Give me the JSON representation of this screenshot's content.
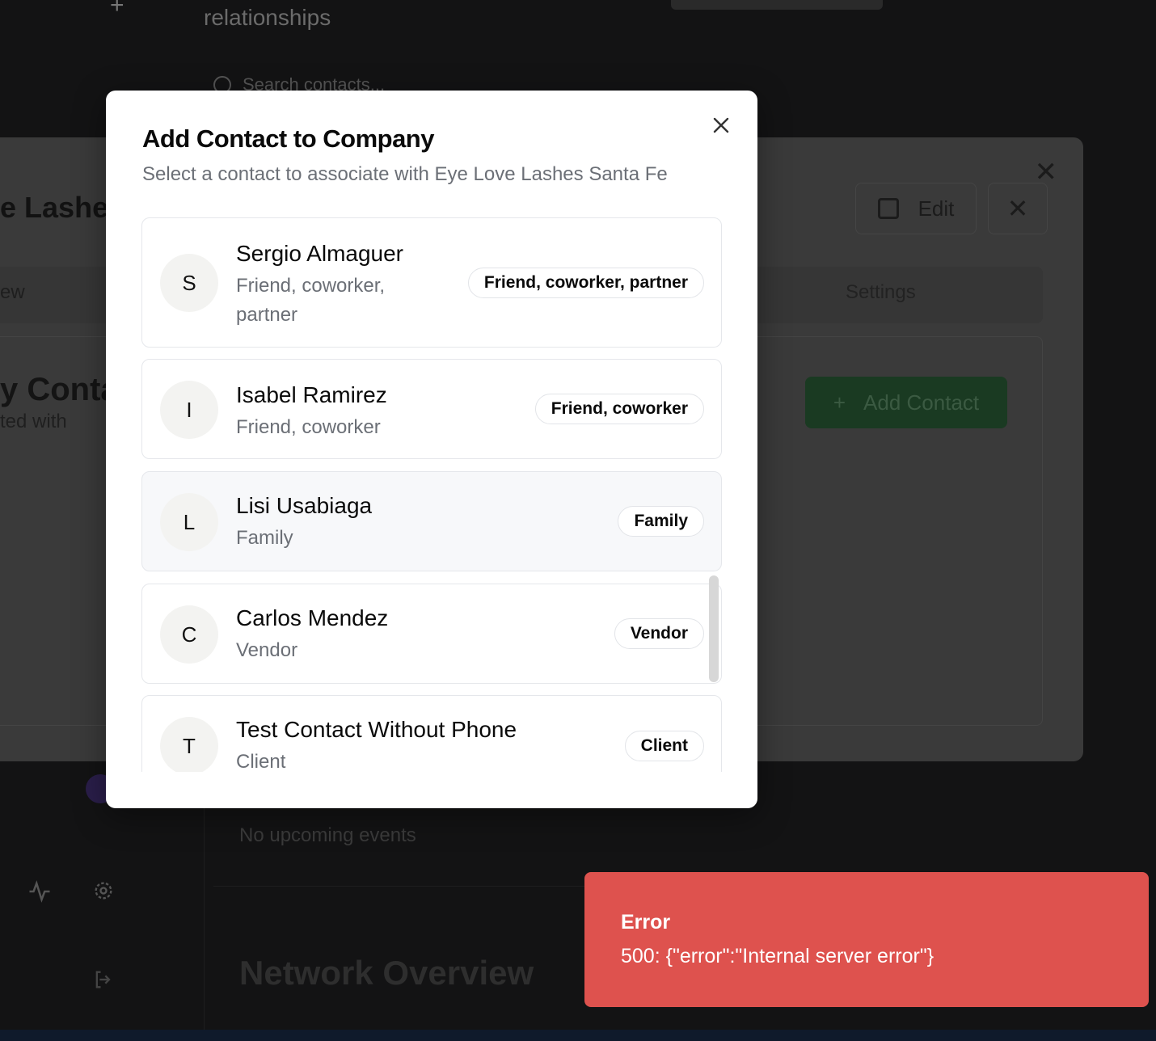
{
  "background": {
    "subtitle": "relationships",
    "search_placeholder": "Search contacts...",
    "no_events": "No upcoming events",
    "network_title": "Network Overview"
  },
  "company_panel": {
    "title": "ye Lashes",
    "edit_label": "Edit",
    "tab_overview_fragment": "ew",
    "tab_settings": "Settings",
    "contacts_title": "y Contac",
    "contacts_subtitle": "ted with",
    "add_contact_label": "Add Contact"
  },
  "modal": {
    "title": "Add Contact to Company",
    "description": "Select a contact to associate with Eye Love Lashes Santa Fe",
    "contacts": [
      {
        "initial": "S",
        "name": "Sergio Almaguer",
        "relationship": "Friend, coworker, partner",
        "badge": "Friend, coworker, partner"
      },
      {
        "initial": "I",
        "name": "Isabel Ramirez",
        "relationship": "Friend, coworker",
        "badge": "Friend, coworker"
      },
      {
        "initial": "L",
        "name": "Lisi Usabiaga",
        "relationship": "Family",
        "badge": "Family"
      },
      {
        "initial": "C",
        "name": "Carlos Mendez",
        "relationship": "Vendor",
        "badge": "Vendor"
      },
      {
        "initial": "T",
        "name": "Test Contact Without Phone",
        "relationship": "Client",
        "badge": "Client"
      }
    ]
  },
  "toast": {
    "title": "Error",
    "message": "500: {\"error\":\"Internal server error\"}",
    "color": "#de524e"
  }
}
